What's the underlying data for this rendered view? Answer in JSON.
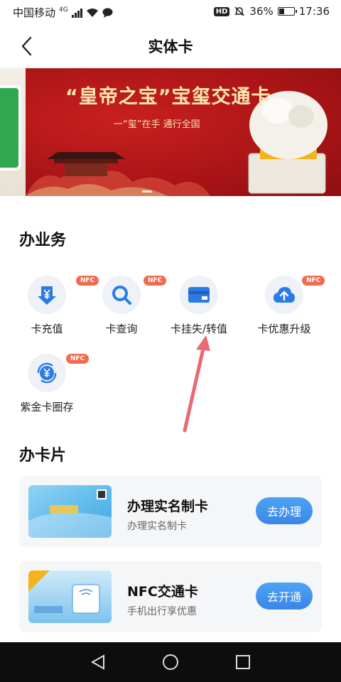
{
  "status_bar": {
    "carrier": "中国移动",
    "network": "4G",
    "battery": "36%",
    "battery_level": 0.36,
    "time": "17:36",
    "hd": "HD"
  },
  "header": {
    "title": "实体卡"
  },
  "banner": {
    "headline": "“皇帝之宝”宝玺交通卡",
    "subline": "一“玺”在手 通行全国"
  },
  "business": {
    "title": "办业务",
    "items": [
      {
        "label": "卡充值",
        "icon": "yuan-down-icon",
        "badge": "NFC"
      },
      {
        "label": "卡查询",
        "icon": "search-icon",
        "badge": "NFC"
      },
      {
        "label": "卡挂失/转值",
        "icon": "card-icon",
        "badge": ""
      },
      {
        "label": "卡优惠升级",
        "icon": "cloud-upload-icon",
        "badge": "NFC"
      },
      {
        "label": "紫金卡圈存",
        "icon": "yuan-refresh-icon",
        "badge": "NFC"
      }
    ]
  },
  "cards": {
    "title": "办卡片",
    "items": [
      {
        "title": "办理实名制卡",
        "subtitle": "办理实名制卡",
        "button": "去办理"
      },
      {
        "title": "NFC交通卡",
        "subtitle": "手机出行享优惠",
        "button": "去开通"
      }
    ]
  },
  "colors": {
    "accent": "#3a86e8",
    "badge": "#f06b4f",
    "banner_red": "#b2161b"
  }
}
